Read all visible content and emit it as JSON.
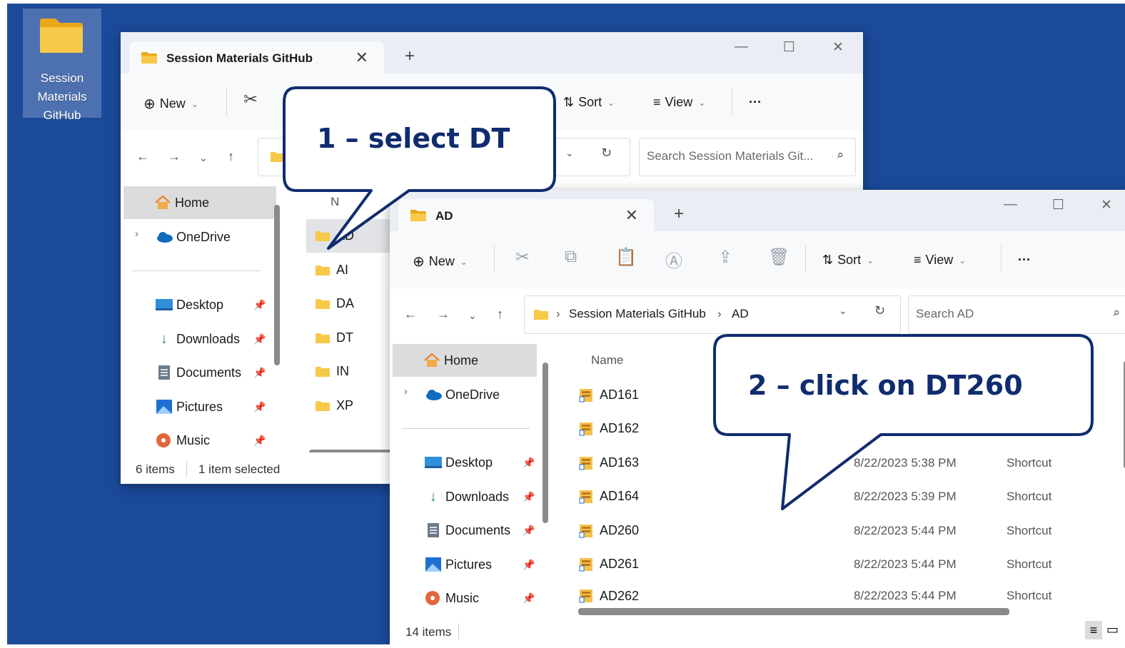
{
  "colors": {
    "desktop": "#1b4a9a",
    "callout_border": "#0f2c6e",
    "folder": "#f7c948"
  },
  "desktop_icon": {
    "label": "Session\nMaterials\nGitHub"
  },
  "back_window": {
    "tab_title": "Session Materials GitHub",
    "toolbar": {
      "new_label": "New",
      "sort_label": "Sort",
      "view_label": "View",
      "more_label": "···"
    },
    "search_placeholder": "Search Session Materials Git...",
    "sidebar": [
      "Home",
      "OneDrive",
      "Desktop",
      "Downloads",
      "Documents",
      "Pictures",
      "Music"
    ],
    "column_header": "N",
    "folders": [
      "AD",
      "AI",
      "DA",
      "DT",
      "IN",
      "XP"
    ],
    "status": {
      "count": "6 items",
      "selection": "1 item selected"
    }
  },
  "front_window": {
    "tab_title": "AD",
    "toolbar": {
      "new_label": "New",
      "sort_label": "Sort",
      "view_label": "View",
      "more_label": "···"
    },
    "breadcrumb": [
      "Session Materials GitHub",
      "AD"
    ],
    "search_placeholder": "Search AD",
    "sidebar": [
      "Home",
      "OneDrive",
      "Desktop",
      "Downloads",
      "Documents",
      "Pictures",
      "Music"
    ],
    "column_header": "Name",
    "files": [
      {
        "name": "AD161",
        "date": "",
        "type": ""
      },
      {
        "name": "AD162",
        "date": "",
        "type": ""
      },
      {
        "name": "AD163",
        "date": "8/22/2023 5:38 PM",
        "type": "Shortcut"
      },
      {
        "name": "AD164",
        "date": "8/22/2023 5:39 PM",
        "type": "Shortcut"
      },
      {
        "name": "AD260",
        "date": "8/22/2023 5:44 PM",
        "type": "Shortcut"
      },
      {
        "name": "AD261",
        "date": "8/22/2023 5:44 PM",
        "type": "Shortcut"
      },
      {
        "name": "AD262",
        "date": "8/22/2023 5:44 PM",
        "type": "Shortcut"
      }
    ],
    "status": {
      "count": "14 items"
    }
  },
  "callouts": [
    {
      "text": "1 – select DT"
    },
    {
      "text": "2 – click on DT260"
    }
  ]
}
